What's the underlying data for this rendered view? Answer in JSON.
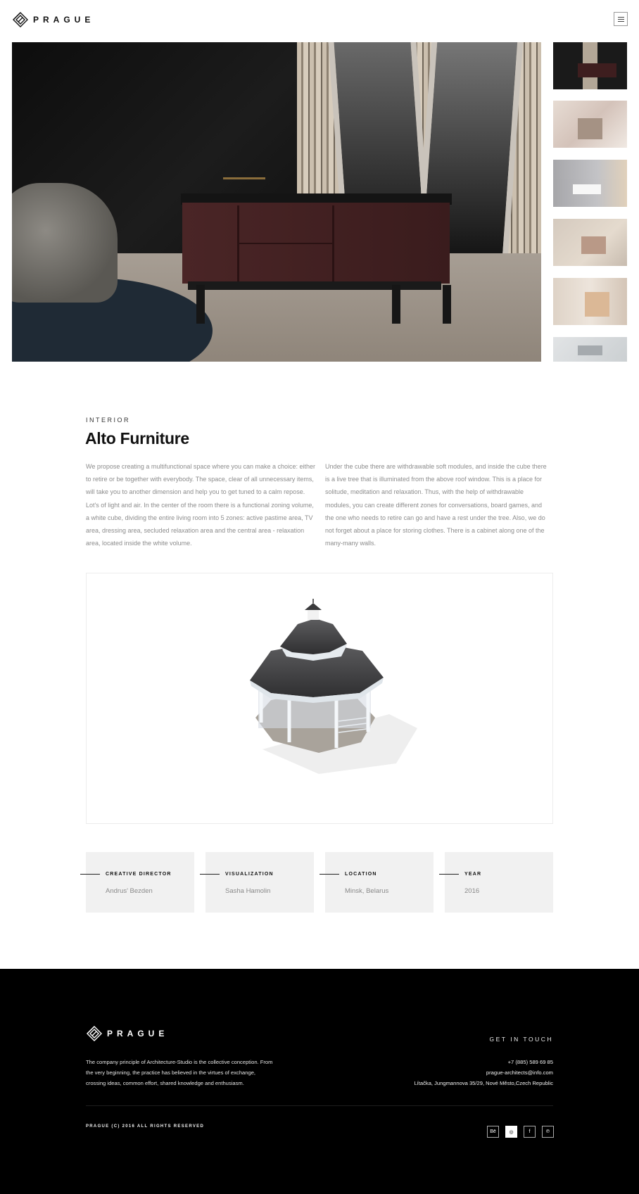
{
  "header": {
    "brand": "PRAGUE",
    "menu_icon": "hamburger-icon"
  },
  "gallery": {
    "thumbnail_count": 6
  },
  "project": {
    "category": "INTERIOR",
    "title": "Alto Furniture",
    "description_left": "We propose creating a multifunctional space where you can make a choice: either to retire or be together with everybody. The space, clear of all unnecessary items, will take you to another dimension and help you to get tuned to a calm repose.  Lot's of light and air. In the center of the room there is a functional zoning volume, a white cube, dividing the entire living room into 5 zones: active pastime area, TV area, dressing area, secluded relaxation area and the central area - relaxation area, located inside the white volume.",
    "description_right": "Under the cube there are withdrawable soft modules, and inside the cube there is a live tree that is illuminated from the above roof window. This is a place for solitude, meditation and relaxation. Thus, with the help of withdrawable modules, you can create different zones for conversations, board games, and the one who needs to retire can go and have a rest under the tree. Also, we do not forget about a place for storing clothes. There is a cabinet along one of the many-many walls."
  },
  "credits": [
    {
      "label": "CREATIVE DIRECTOR",
      "value": "Andrus' Bezden"
    },
    {
      "label": "VISUALIZATION",
      "value": "Sasha Hamolin"
    },
    {
      "label": "LOCATION",
      "value": "Minsk, Belarus"
    },
    {
      "label": "YEAR",
      "value": "2016"
    }
  ],
  "footer": {
    "brand": "PRAGUE",
    "description": "The company principle of Architecture-Studio is the collective conception. From the very beginning, the practice has believed in the virtues of exchange, crossing ideas, common effort, shared knowledge and enthusiasm.",
    "get_in_touch": "GET IN TOUCH",
    "phone": "+7 (885) 589 69 85",
    "email": "prague-architects@info.com",
    "address": "Lítačka, Jungmannova 35/29, Nové Město,Czech Republic",
    "copyright": "PRAGUE (C) 2016 ALL RIGHTS RESERVED",
    "social": [
      {
        "label": "Bē",
        "icon": "behance-icon"
      },
      {
        "label": "◎",
        "icon": "dribbble-icon"
      },
      {
        "label": "f",
        "icon": "facebook-icon"
      },
      {
        "label": "℗",
        "icon": "pinterest-icon"
      }
    ]
  }
}
